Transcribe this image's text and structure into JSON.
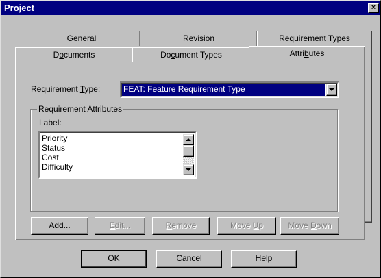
{
  "window": {
    "title": "Project",
    "close_glyph": "×"
  },
  "tabs_back": [
    {
      "pre": "",
      "u": "G",
      "post": "eneral"
    },
    {
      "pre": "Re",
      "u": "v",
      "post": "ision"
    },
    {
      "pre": "Re",
      "u": "q",
      "post": "uirement Types"
    }
  ],
  "tabs_front": [
    {
      "pre": "D",
      "u": "o",
      "post": "cuments"
    },
    {
      "pre": "Do",
      "u": "c",
      "post": "ument Types"
    },
    {
      "pre": "Attri",
      "u": "b",
      "post": "utes",
      "active": true
    }
  ],
  "req_type": {
    "label_pre": "Requirement ",
    "label_u": "T",
    "label_post": "ype:",
    "value": "FEAT: Feature Requirement Type"
  },
  "group": {
    "title": "Requirement Attributes",
    "list_label": "Label:"
  },
  "list_items": [
    "Priority",
    "Status",
    "Cost",
    "Difficulty"
  ],
  "action_buttons": [
    {
      "pre": "",
      "u": "A",
      "post": "dd...",
      "enabled": true
    },
    {
      "pre": "",
      "u": "E",
      "post": "dit...",
      "enabled": false
    },
    {
      "pre": "",
      "u": "R",
      "post": "emove",
      "enabled": false
    },
    {
      "pre": "Move ",
      "u": "U",
      "post": "p",
      "enabled": false
    },
    {
      "pre": "Move ",
      "u": "D",
      "post": "own",
      "enabled": false
    }
  ],
  "dialog_buttons": {
    "ok": "OK",
    "cancel": "Cancel",
    "help": {
      "pre": "",
      "u": "H",
      "post": "elp"
    }
  },
  "icons": {
    "dropdown": "chevron-down-icon",
    "scroll_up": "scroll-up-icon",
    "scroll_down": "scroll-down-icon"
  }
}
